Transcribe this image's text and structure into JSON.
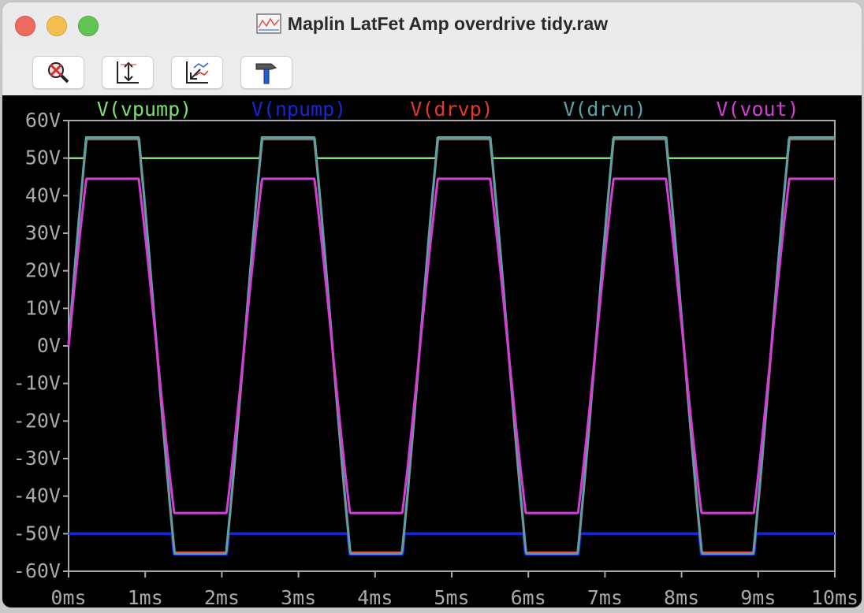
{
  "window": {
    "title": "Maplin LatFet Amp overdrive tidy.raw",
    "controls": [
      "close",
      "minimize",
      "maximize"
    ]
  },
  "toolbar": {
    "buttons": [
      {
        "name": "autoscale",
        "icon": "magnifier-cross-icon"
      },
      {
        "name": "vertical-scale",
        "icon": "vertical-scale-icon"
      },
      {
        "name": "pan",
        "icon": "plot-arrow-icon"
      },
      {
        "name": "settings",
        "icon": "hammer-icon"
      }
    ]
  },
  "colors": {
    "background": "#000000",
    "axis": "#a9a9a9",
    "vpump": "#7ce06e",
    "npump": "#1428d8",
    "drvp": "#e0392c",
    "drvn": "#5aa0a6",
    "vout": "#d43ed6"
  },
  "chart_data": {
    "type": "line",
    "xlabel": "",
    "ylabel": "",
    "xlim": [
      0,
      10
    ],
    "ylim": [
      -60,
      60
    ],
    "x_ticks": [
      "0ms",
      "1ms",
      "2ms",
      "3ms",
      "4ms",
      "5ms",
      "6ms",
      "7ms",
      "8ms",
      "9ms",
      "10ms"
    ],
    "y_ticks": [
      "60V",
      "50V",
      "40V",
      "30V",
      "20V",
      "10V",
      "0V",
      "-10V",
      "-20V",
      "-30V",
      "-40V",
      "-50V",
      "-60V"
    ],
    "legend_position": "top",
    "signal": {
      "frequency_khz": 0.436,
      "period_ms": 2.29
    },
    "series": [
      {
        "name": "V(vpump)",
        "color": "#7ce06e",
        "rail": 50,
        "peak": 55.5,
        "description": "50V with bumps to 55.5V at peaks"
      },
      {
        "name": "V(npump)",
        "color": "#1428d8",
        "rail": -50,
        "peak": -55.5,
        "description": "-50V with dips to -55.5V at troughs"
      },
      {
        "name": "V(drvp)",
        "color": "#e0392c",
        "amplitude": 55,
        "description": "sine clipped at about ±55V"
      },
      {
        "name": "V(drvn)",
        "color": "#5aa0a6",
        "amplitude": 55,
        "description": "sine clipped at about ±55V"
      },
      {
        "name": "V(vout)",
        "color": "#d43ed6",
        "amplitude": 44.5,
        "description": "sine clipped at ±44.5V"
      }
    ]
  }
}
